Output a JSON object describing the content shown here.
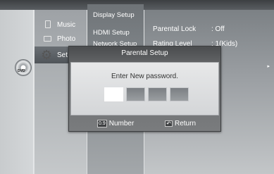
{
  "main_menu": {
    "items": [
      {
        "label": "Music",
        "icon": "music-icon"
      },
      {
        "label": "Photo",
        "icon": "photo-icon"
      },
      {
        "label": "Set",
        "icon": "gear-icon"
      }
    ],
    "disc_label": "DVD"
  },
  "submenu": {
    "items": [
      "Display Setup",
      "HDMI Setup",
      "Network Setup"
    ]
  },
  "settings": {
    "rows": [
      {
        "label": "Parental Lock",
        "value": ": Off"
      },
      {
        "label": "Rating Level",
        "value": ": 1(Kids)"
      }
    ],
    "arrow": "▸"
  },
  "dialog": {
    "title": "Parental Setup",
    "message": "Enter New password.",
    "password_box_count": 4,
    "active_box_index": 0,
    "footer": {
      "number_icon": "0.9",
      "number_label": "Number",
      "return_icon": "↶",
      "return_label": "Return"
    }
  }
}
